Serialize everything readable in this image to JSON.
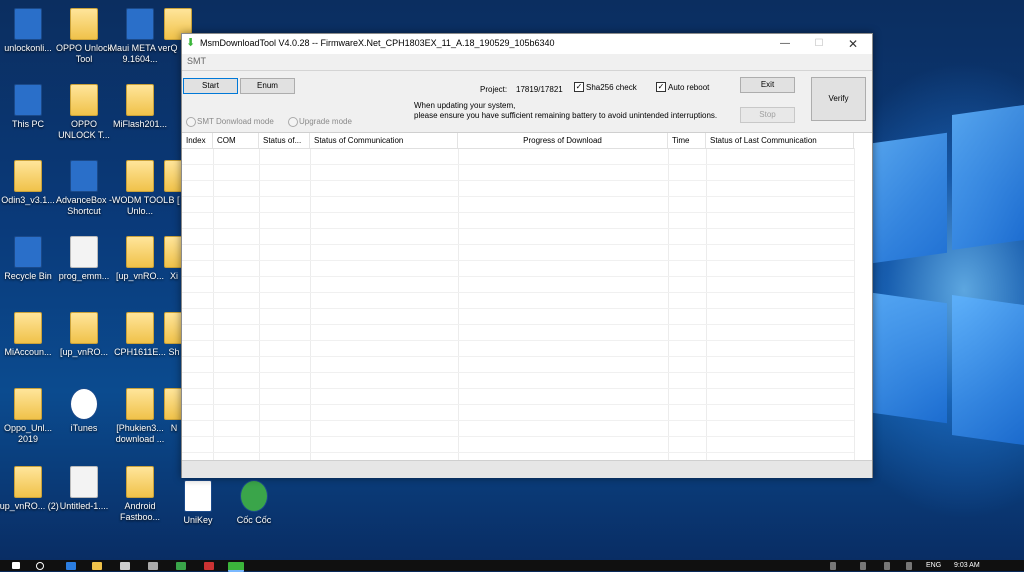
{
  "desktop": {
    "icons": [
      {
        "label": "unlockonli...",
        "kind": "app"
      },
      {
        "label": "OPPO Unlock Tool",
        "kind": "folder"
      },
      {
        "label": "Maui META ver 9.1604...",
        "kind": "app"
      },
      {
        "label": "Q",
        "kind": "folder"
      },
      {
        "label": "This PC",
        "kind": "app"
      },
      {
        "label": "OPPO UNLOCK T...",
        "kind": "folder"
      },
      {
        "label": "MiFlash201...",
        "kind": "folder"
      },
      {
        "label": "Odin3_v3.1...",
        "kind": "folder"
      },
      {
        "label": "AdvanceBox - Shortcut",
        "kind": "app"
      },
      {
        "label": "WODM TOOL Unlo...",
        "kind": "folder"
      },
      {
        "label": "B [",
        "kind": "folder"
      },
      {
        "label": "Recycle Bin",
        "kind": "app"
      },
      {
        "label": "prog_emm...",
        "kind": "file"
      },
      {
        "label": "[up_vnRO...",
        "kind": "folder"
      },
      {
        "label": "Xi",
        "kind": "folder"
      },
      {
        "label": "MiAccoun...",
        "kind": "folder"
      },
      {
        "label": "[up_vnRO...",
        "kind": "folder"
      },
      {
        "label": "CPH1611E...",
        "kind": "folder"
      },
      {
        "label": "Sh",
        "kind": "folder"
      },
      {
        "label": "Oppo_Unl... 2019",
        "kind": "folder"
      },
      {
        "label": "iTunes",
        "kind": "app"
      },
      {
        "label": "[Phukien3... download ...",
        "kind": "folder"
      },
      {
        "label": "N",
        "kind": "folder"
      },
      {
        "label": "[up_vnRO... (2)",
        "kind": "folder"
      },
      {
        "label": "Untitled-1....",
        "kind": "file"
      },
      {
        "label": "Android Fastboo...",
        "kind": "folder"
      },
      {
        "label": "UniKey",
        "kind": "app"
      },
      {
        "label": "Cốc Cốc",
        "kind": "app"
      }
    ]
  },
  "window": {
    "title": "MsmDownloadTool V4.0.28 -- FirmwareX.Net_CPH1803EX_11_A.18_190529_105b6340",
    "minimize": "—",
    "maximize": "☐",
    "close": "✕",
    "mode_label": "SMT",
    "buttons": {
      "start": "Start",
      "enum": "Enum",
      "exit": "Exit",
      "stop": "Stop",
      "verify": "Verify"
    },
    "project_label": "Project:",
    "project_value": "17819/17821",
    "sha256_label": "Sha256 check",
    "sha256_checked": true,
    "auto_reboot_label": "Auto reboot",
    "auto_reboot_checked": true,
    "notice_line1": "When updating your system,",
    "notice_line2": "please ensure you have sufficient remaining battery to avoid unintended interruptions.",
    "radio_smt": "SMT Donwload mode",
    "radio_upgrade": "Upgrade mode",
    "columns": [
      "Index",
      "COM",
      "Status of...",
      "Status of Communication",
      "Progress of Download",
      "Time",
      "Status of Last Communication"
    ]
  },
  "taskbar": {
    "lang": "ENG",
    "time": "9:03 AM"
  },
  "colors": {
    "accent": "#0078d7",
    "desktop": "#0b3a7a"
  }
}
